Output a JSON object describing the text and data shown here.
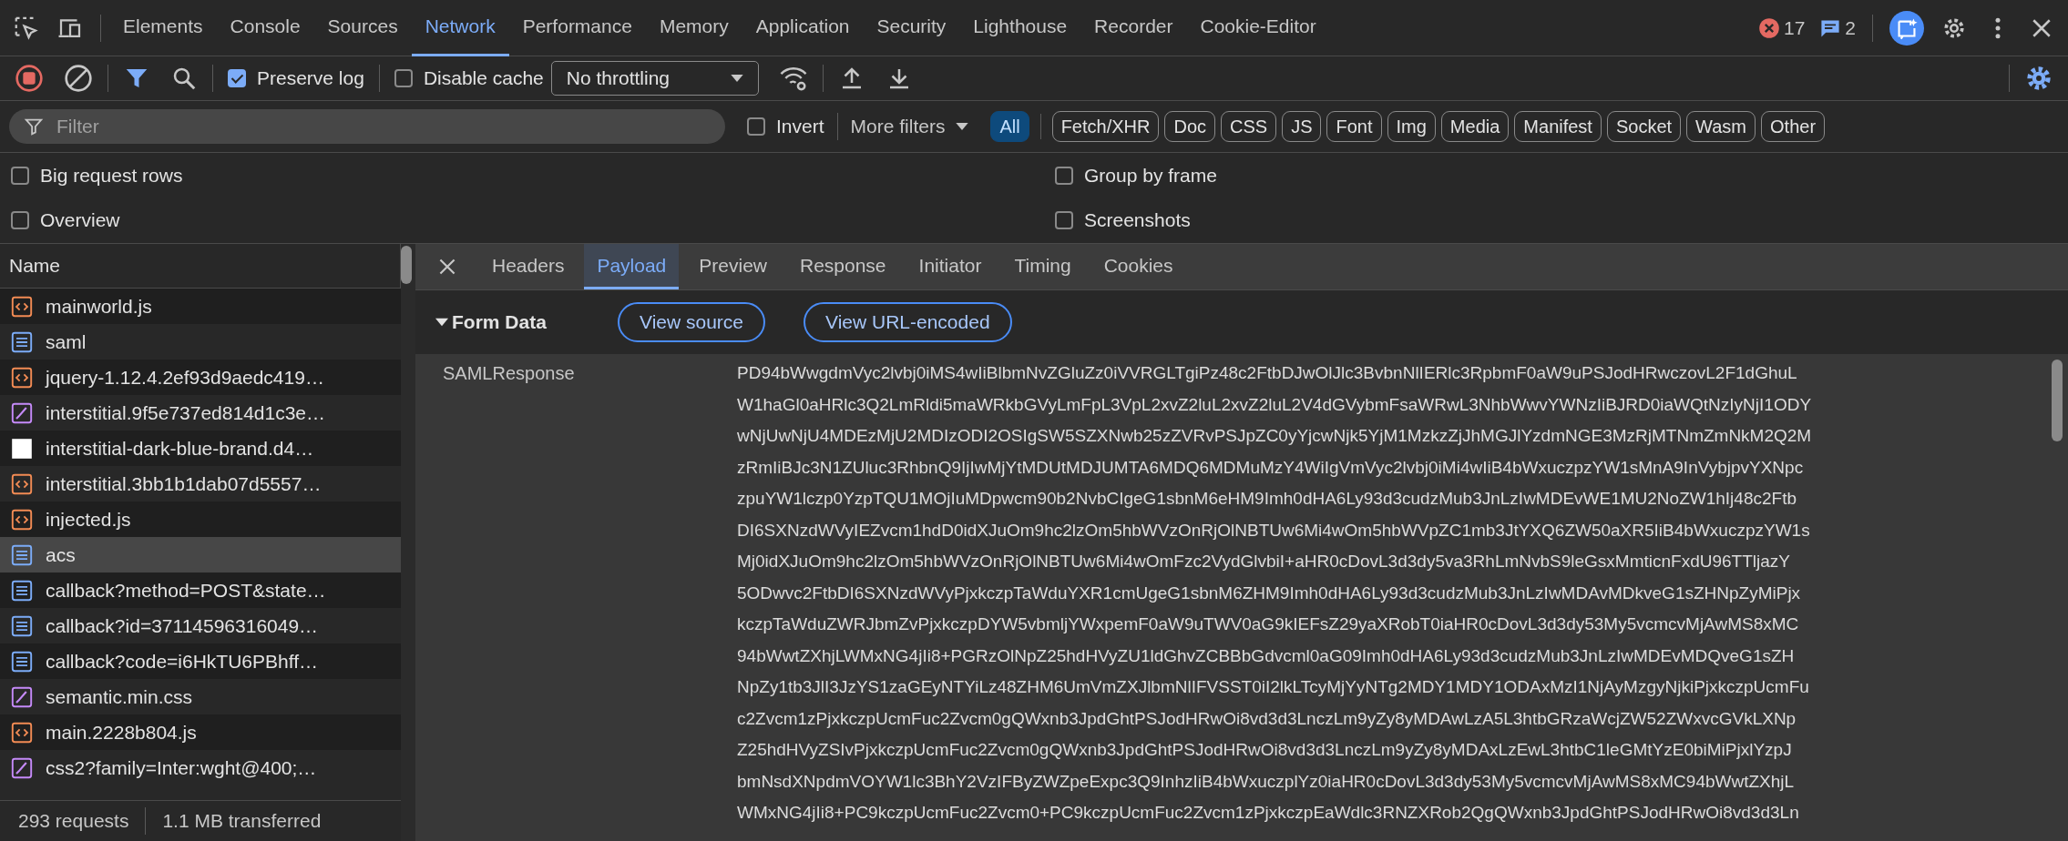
{
  "main_tabs": [
    {
      "label": "Elements",
      "selected": false
    },
    {
      "label": "Console",
      "selected": false
    },
    {
      "label": "Sources",
      "selected": false
    },
    {
      "label": "Network",
      "selected": true
    },
    {
      "label": "Performance",
      "selected": false
    },
    {
      "label": "Memory",
      "selected": false
    },
    {
      "label": "Application",
      "selected": false
    },
    {
      "label": "Security",
      "selected": false
    },
    {
      "label": "Lighthouse",
      "selected": false
    },
    {
      "label": "Recorder",
      "selected": false
    },
    {
      "label": "Cookie-Editor",
      "selected": false
    }
  ],
  "issues": {
    "errors": "17",
    "messages": "2"
  },
  "toolbar": {
    "recording": true,
    "filter_active": true,
    "preserve_log": {
      "label": "Preserve log",
      "checked": true
    },
    "disable_cache": {
      "label": "Disable cache",
      "checked": false
    },
    "throttling": "No throttling"
  },
  "filter": {
    "placeholder": "Filter",
    "invert": {
      "label": "Invert",
      "checked": false
    },
    "more_filters": "More filters",
    "types": [
      {
        "label": "All",
        "selected": true
      },
      {
        "label": "Fetch/XHR",
        "selected": false
      },
      {
        "label": "Doc",
        "selected": false
      },
      {
        "label": "CSS",
        "selected": false
      },
      {
        "label": "JS",
        "selected": false
      },
      {
        "label": "Font",
        "selected": false
      },
      {
        "label": "Img",
        "selected": false
      },
      {
        "label": "Media",
        "selected": false
      },
      {
        "label": "Manifest",
        "selected": false
      },
      {
        "label": "Socket",
        "selected": false
      },
      {
        "label": "Wasm",
        "selected": false
      },
      {
        "label": "Other",
        "selected": false
      }
    ]
  },
  "options": [
    {
      "label": "Big request rows",
      "checked": false
    },
    {
      "label": "Group by frame",
      "checked": false
    },
    {
      "label": "Overview",
      "checked": false
    },
    {
      "label": "Screenshots",
      "checked": false
    }
  ],
  "requests": {
    "column": "Name",
    "rows": [
      {
        "name": "mainworld.js",
        "kind": "script",
        "selected": false
      },
      {
        "name": "saml",
        "kind": "document",
        "selected": false
      },
      {
        "name": "jquery-1.12.4.2ef93d9aedc419…",
        "kind": "script",
        "selected": false
      },
      {
        "name": "interstitial.9f5e737ed814d1c3e…",
        "kind": "stylesheet",
        "selected": false
      },
      {
        "name": "interstitial-dark-blue-brand.d4…",
        "kind": "image",
        "selected": false
      },
      {
        "name": "interstitial.3bb1b1dab07d5557…",
        "kind": "script",
        "selected": false
      },
      {
        "name": "injected.js",
        "kind": "script",
        "selected": false
      },
      {
        "name": "acs",
        "kind": "document",
        "selected": true
      },
      {
        "name": "callback?method=POST&state…",
        "kind": "document",
        "selected": false
      },
      {
        "name": "callback?id=37114596316049…",
        "kind": "document",
        "selected": false
      },
      {
        "name": "callback?code=i6HkTU6PBhff…",
        "kind": "document",
        "selected": false
      },
      {
        "name": "semantic.min.css",
        "kind": "stylesheet",
        "selected": false
      },
      {
        "name": "main.2228b804.js",
        "kind": "script",
        "selected": false
      },
      {
        "name": "css2?family=Inter:wght@400;…",
        "kind": "stylesheet",
        "selected": false
      }
    ]
  },
  "summary": [
    "293 requests",
    "1.1 MB transferred"
  ],
  "detail": {
    "tabs": [
      {
        "label": "Headers",
        "selected": false
      },
      {
        "label": "Payload",
        "selected": true
      },
      {
        "label": "Preview",
        "selected": false
      },
      {
        "label": "Response",
        "selected": false
      },
      {
        "label": "Initiator",
        "selected": false
      },
      {
        "label": "Timing",
        "selected": false
      },
      {
        "label": "Cookies",
        "selected": false
      }
    ],
    "section": {
      "title": "Form Data",
      "expanded": true,
      "buttons": [
        "View source",
        "View URL-encoded"
      ]
    },
    "fields": [
      {
        "key": "SAMLResponse",
        "value_lines": [
          "PD94bWwgdmVyc2lvbj0iMS4wIiBlbmNvZGluZz0iVVRGLTgiPz48c2FtbDJwOlJlc3BvbnNlIERlc3RpbmF0aW9uPSJodHRwczovL2F1dGhuL",
          "W1haGl0aHRlc3Q2LmRldi5maWRkbGVyLmFpL3VpL2xvZ2luL2xvZ2luL2V4dGVybmFsaWRwL3NhbWwvYWNzIiBJRD0iaWQtNzIyNjI1ODY",
          "wNjUwNjU4MDEzMjU2MDIzODI2OSIgSW5SZXNwb25zZVRvPSJpZC0yYjcwNjk5YjM1MzkzZjJhMGJlYzdmNGE3MzRjMTNmZmNkM2Q2M",
          "zRmIiBJc3N1ZUluc3RhbnQ9IjIwMjYtMDUtMDJUMTA6MDQ6MDMuMzY4WiIgVmVyc2lvbj0iMi4wIiB4bWxuczpzYW1sMnA9InVybjpvYXNpc",
          "zpuYW1lczp0YzpTQU1MOjIuMDpwcm90b2NvbCIgeG1sbnM6eHM9Imh0dHA6Ly93d3cudzMub3JnLzIwMDEvWE1MU2NoZW1hIj48c2Ftb",
          "DI6SXNzdWVyIEZvcm1hdD0idXJuOm9hc2lzOm5hbWVzOnRjOlNBTUw6Mi4wOm5hbWVpZC1mb3JtYXQ6ZW50aXR5IiB4bWxuczpzYW1s",
          "Mj0idXJuOm9hc2lzOm5hbWVzOnRjOlNBTUw6Mi4wOmFzc2VydGlvbiI+aHR0cDovL3d3dy5va3RhLmNvbS9leGsxMmticnFxdU96TTljazY",
          "5ODwvc2FtbDI6SXNzdWVyPjxkczpTaWduYXR1cmUgeG1sbnM6ZHM9Imh0dHA6Ly93d3cudzMub3JnLzIwMDAvMDkveG1sZHNpZyMiPjx",
          "kczpTaWduZWRJbmZvPjxkczpDYW5vbmljYWxpemF0aW9uTWV0aG9kIEFsZ29yaXRobT0iaHR0cDovL3d3dy53My5vcmcvMjAwMS8xMC",
          "94bWwtZXhjLWMxNG4jIi8+PGRzOlNpZ25hdHVyZU1ldGhvZCBBbGdvcml0aG09Imh0dHA6Ly93d3cudzMub3JnLzIwMDEvMDQveG1sZH",
          "NpZy1tb3JlI3JzYS1zaGEyNTYiLz48ZHM6UmVmZXJlbmNlIFVSST0iI2lkLTcyMjYyNTg2MDY1MDY1ODAxMzI1NjAyMzgyNjkiPjxkczpUcmFu",
          "c2Zvcm1zPjxkczpUcmFuc2Zvcm0gQWxnb3JpdGhtPSJodHRwOi8vd3d3LnczLm9yZy8yMDAwLzA5L3htbGRzaWcjZW52ZWxvcGVkLXNp",
          "Z25hdHVyZSIvPjxkczpUcmFuc2Zvcm0gQWxnb3JpdGhtPSJodHRwOi8vd3d3LnczLm9yZy8yMDAxLzEwL3htbC1leGMtYzE0biMiPjxlYzpJ",
          "bmNsdXNpdmVOYW1lc3BhY2VzIFByZWZpeExpc3Q9InhzIiB4bWxuczplYz0iaHR0cDovL3d3dy53My5vcmcvMjAwMS8xMC94bWwtZXhjL",
          "WMxNG4jIi8+PC9kczpUcmFuc2Zvcm0+PC9kczpUcmFuc2Zvcm1zPjxkczpEaWdlc3RNZXRob2QgQWxnb3JpdGhtPSJodHRwOi8vd3d3Ln"
        ]
      }
    ]
  }
}
